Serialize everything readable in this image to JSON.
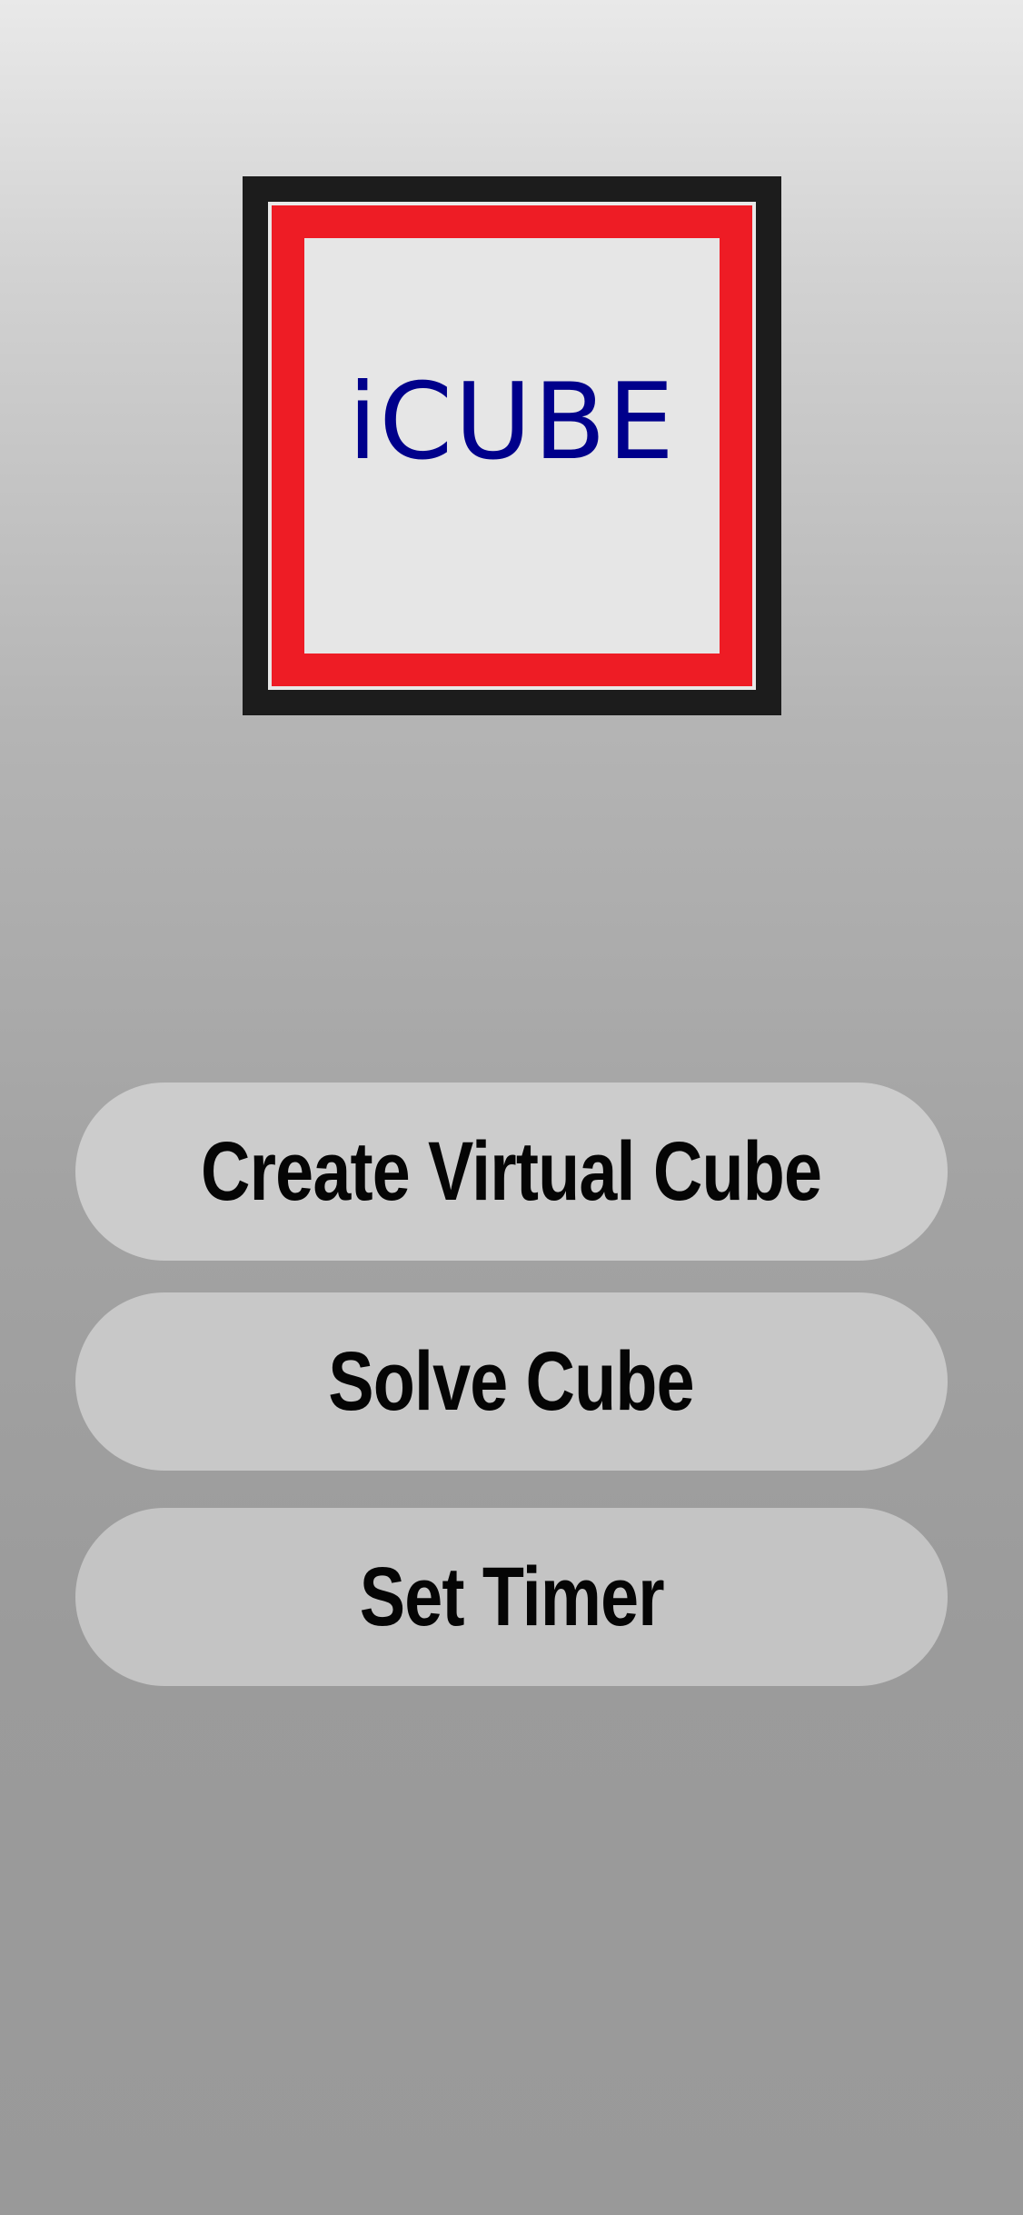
{
  "app": {
    "logo_text": "iCUBE"
  },
  "menu": {
    "buttons": [
      {
        "label": "Create Virtual Cube"
      },
      {
        "label": "Solve Cube"
      },
      {
        "label": "Set Timer"
      }
    ]
  },
  "colors": {
    "logo_frame": "#1c1c1c",
    "logo_border": "#ee1c25",
    "logo_text": "#00008b",
    "button_bg": "#c8c8c8"
  }
}
